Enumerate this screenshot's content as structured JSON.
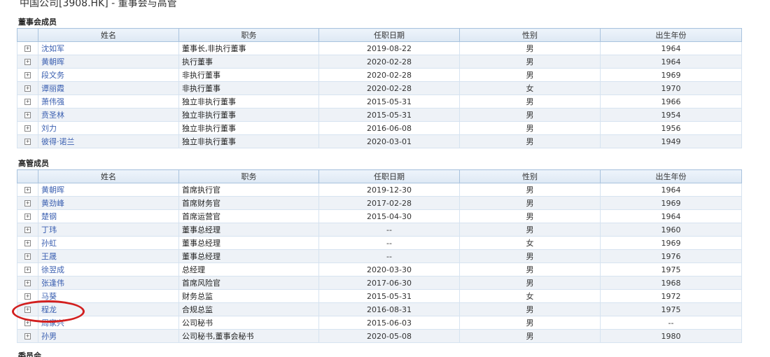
{
  "page": {
    "title": "中国公司[3908.HK] - 董事会与高管"
  },
  "colors": {
    "highlight": "#d21f1f",
    "link": "#3a5fb0",
    "header_border": "#a9c3de"
  },
  "icons": {
    "expand": "expand-plus-icon"
  },
  "board": {
    "title": "董事会成员",
    "headers": [
      "姓名",
      "职务",
      "任职日期",
      "性别",
      "出生年份"
    ],
    "rows": [
      {
        "name": "沈如军",
        "position": "董事长,非执行董事",
        "date": "2019-08-22",
        "gender": "男",
        "birth": "1964"
      },
      {
        "name": "黄朝晖",
        "position": "执行董事",
        "date": "2020-02-28",
        "gender": "男",
        "birth": "1964"
      },
      {
        "name": "段文务",
        "position": "非执行董事",
        "date": "2020-02-28",
        "gender": "男",
        "birth": "1969"
      },
      {
        "name": "谭丽霞",
        "position": "非执行董事",
        "date": "2020-02-28",
        "gender": "女",
        "birth": "1970"
      },
      {
        "name": "萧伟强",
        "position": "独立非执行董事",
        "date": "2015-05-31",
        "gender": "男",
        "birth": "1966"
      },
      {
        "name": "贲圣林",
        "position": "独立非执行董事",
        "date": "2015-05-31",
        "gender": "男",
        "birth": "1954"
      },
      {
        "name": "刘力",
        "position": "独立非执行董事",
        "date": "2016-06-08",
        "gender": "男",
        "birth": "1956"
      },
      {
        "name": "彼得·诺兰",
        "position": "独立非执行董事",
        "date": "2020-03-01",
        "gender": "男",
        "birth": "1949"
      }
    ]
  },
  "executives": {
    "title": "高管成员",
    "headers": [
      "姓名",
      "职务",
      "任职日期",
      "性别",
      "出生年份"
    ],
    "rows": [
      {
        "name": "黄朝晖",
        "position": "首席执行官",
        "date": "2019-12-30",
        "gender": "男",
        "birth": "1964"
      },
      {
        "name": "黄劲峰",
        "position": "首席财务官",
        "date": "2017-02-28",
        "gender": "男",
        "birth": "1969"
      },
      {
        "name": "楚钢",
        "position": "首席运营官",
        "date": "2015-04-30",
        "gender": "男",
        "birth": "1964"
      },
      {
        "name": "丁玮",
        "position": "董事总经理",
        "date": "--",
        "gender": "男",
        "birth": "1960"
      },
      {
        "name": "孙虹",
        "position": "董事总经理",
        "date": "--",
        "gender": "女",
        "birth": "1969"
      },
      {
        "name": "王晟",
        "position": "董事总经理",
        "date": "--",
        "gender": "男",
        "birth": "1976"
      },
      {
        "name": "徐翌成",
        "position": "总经理",
        "date": "2020-03-30",
        "gender": "男",
        "birth": "1975"
      },
      {
        "name": "张逢伟",
        "position": "首席风险官",
        "date": "2017-06-30",
        "gender": "男",
        "birth": "1968"
      },
      {
        "name": "马葵",
        "position": "财务总监",
        "date": "2015-05-31",
        "gender": "女",
        "birth": "1972"
      },
      {
        "name": "程龙",
        "position": "合规总监",
        "date": "2016-08-31",
        "gender": "男",
        "birth": "1975"
      },
      {
        "name": "周家兴",
        "position": "公司秘书",
        "date": "2015-06-03",
        "gender": "男",
        "birth": "--"
      },
      {
        "name": "孙男",
        "position": "公司秘书,董事会秘书",
        "date": "2020-05-08",
        "gender": "男",
        "birth": "1980"
      }
    ]
  },
  "next_section": {
    "title": "委员会"
  }
}
